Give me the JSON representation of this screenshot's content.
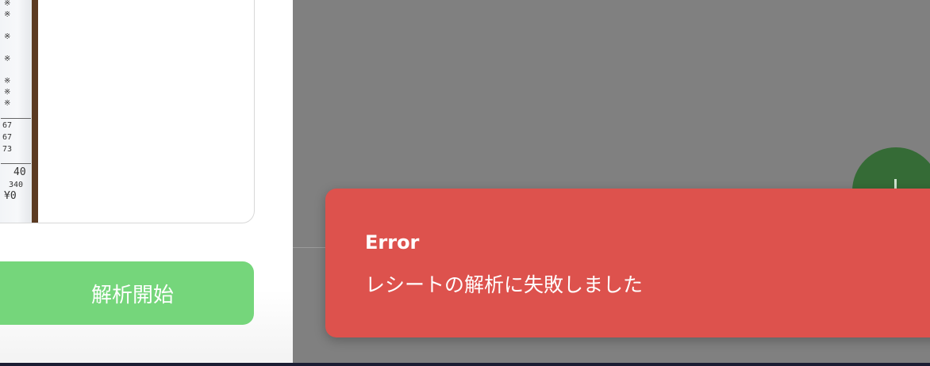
{
  "receipt": {
    "lines": [
      "※",
      "※",
      "※",
      "※",
      "※",
      "※",
      "※",
      "※",
      "67",
      "67",
      "73",
      "40",
      "340",
      "¥0"
    ]
  },
  "actions": {
    "analyze_label": "解析開始"
  },
  "toast": {
    "title": "Error",
    "message": "レシートの解析に失敗しました"
  },
  "colors": {
    "overlay": "#808080",
    "analyze_button": "#75d67b",
    "toast_background": "#dd524d",
    "fab": "#356b36",
    "bottom_bar": "#1b1d33"
  },
  "icons": {
    "fab_icon": "plus-icon"
  }
}
